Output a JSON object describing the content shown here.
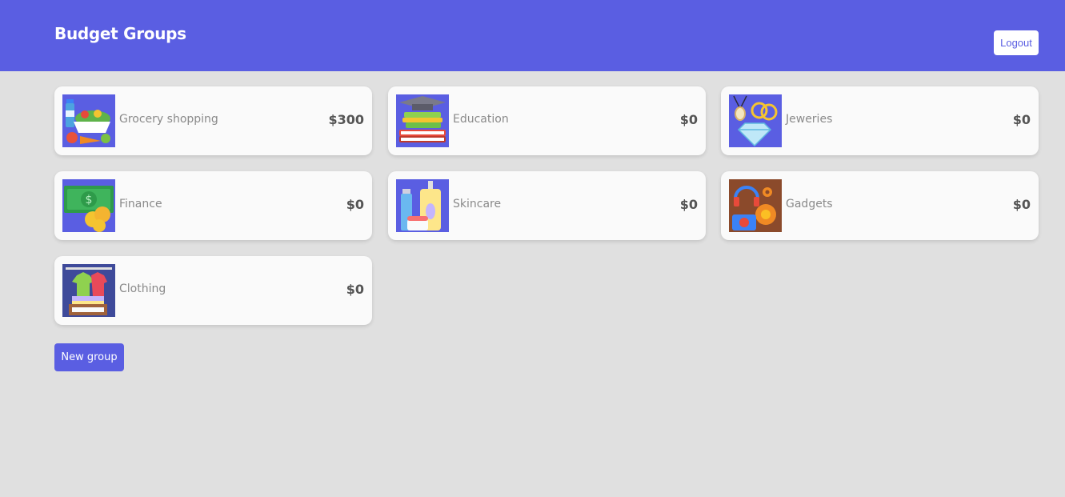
{
  "header": {
    "title": "Budget Groups",
    "logout_label": "Logout"
  },
  "groups": [
    {
      "name": "Grocery shopping",
      "amount": "$300",
      "icon": "grocery-icon"
    },
    {
      "name": "Education",
      "amount": "$0",
      "icon": "education-icon"
    },
    {
      "name": "Jeweries",
      "amount": "$0",
      "icon": "jewelry-icon"
    },
    {
      "name": "Finance",
      "amount": "$0",
      "icon": "finance-icon"
    },
    {
      "name": "Skincare",
      "amount": "$0",
      "icon": "skincare-icon"
    },
    {
      "name": "Gadgets",
      "amount": "$0",
      "icon": "gadgets-icon"
    },
    {
      "name": "Clothing",
      "amount": "$0",
      "icon": "clothing-icon"
    }
  ],
  "actions": {
    "new_group_label": "New group"
  },
  "colors": {
    "primary": "#5a5ee2",
    "background": "#e0e0e0",
    "card": "#fafafa"
  }
}
